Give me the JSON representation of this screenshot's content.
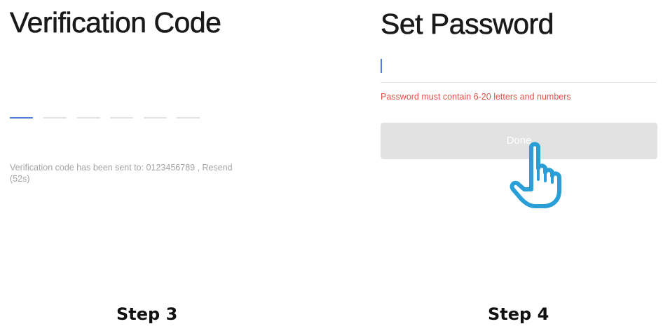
{
  "verification_screen": {
    "title": "Verification Code",
    "code_slot_count": 6,
    "active_slot": 1,
    "hint_prefix": "Verification code has been sent to: 0123456789",
    "resend_label": ", Resend",
    "countdown": "(52s)",
    "step_label": "Step 3"
  },
  "password_screen": {
    "title": "Set Password",
    "password_value": "",
    "password_placeholder": "",
    "error_message": "Password must contain 6-20 letters and numbers",
    "done_label": "Done",
    "pointer_icon": "hand-pointer-icon",
    "step_label": "Step 4"
  },
  "colors": {
    "accent": "#4a80d8",
    "error": "#e3524b",
    "button_disabled": "#e2e2e2",
    "hand_outline": "#2a9ed6"
  }
}
